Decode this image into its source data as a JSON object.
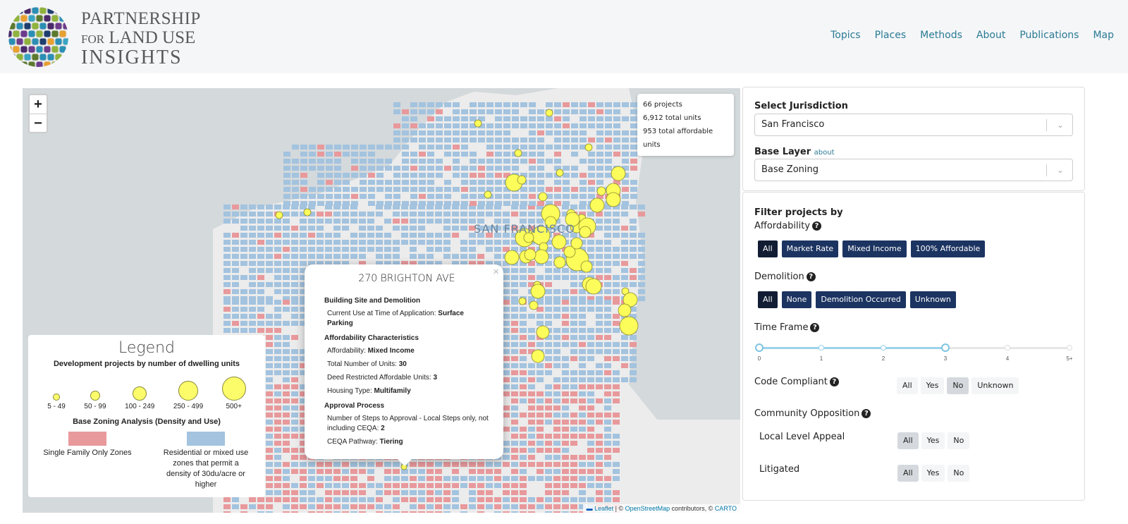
{
  "header": {
    "brand": {
      "line1": "PARTNERSHIP",
      "line2_small": "FOR",
      "line2": "LAND USE",
      "line3": "INSIGHTS"
    },
    "nav": [
      "Topics",
      "Places",
      "Methods",
      "About",
      "Publications",
      "Map"
    ]
  },
  "map": {
    "zoom_in": "+",
    "zoom_out": "−",
    "city_label": "SAN FRANCISCO",
    "stats": {
      "projects": "66 projects",
      "total_units": "6,912 total units",
      "affordable_units": "953 total affordable units"
    },
    "attribution": {
      "leaflet": "Leaflet",
      "sep": " | © ",
      "osm": "OpenStreetMap",
      "contrib": " contributors, © ",
      "carto": "CARTO"
    },
    "colors": {
      "water": "#d4d9dc",
      "land": "#ececec",
      "single_family": "#e8999c",
      "residential_mixed": "#a3c3df",
      "project": "#fcfc5a"
    },
    "legend": {
      "title": "Legend",
      "subtitle": "Development projects by number of dwelling units",
      "sizes": [
        "5 - 49",
        "50 - 99",
        "100 - 249",
        "250 - 499",
        "500+"
      ],
      "zoning_title": "Base Zoning Analysis (Density and Use)",
      "zones": [
        {
          "label": "Single Family Only Zones",
          "color": "#e8999c"
        },
        {
          "label": "Residential or mixed use zones that permit a density of 30du/acre or higher",
          "color": "#a3c3df"
        }
      ]
    },
    "popup": {
      "title": "270 BRIGHTON AVE",
      "close": "×",
      "sections": [
        {
          "heading": "Building Site and Demolition",
          "rows": [
            {
              "k": "Current Use at Time of Application: ",
              "v": "Surface Parking"
            }
          ]
        },
        {
          "heading": "Affordability Characteristics",
          "rows": [
            {
              "k": "Affordability: ",
              "v": "Mixed Income"
            },
            {
              "k": "Total Number of Units: ",
              "v": "30"
            },
            {
              "k": "Deed Restricted Affordable Units: ",
              "v": "3"
            },
            {
              "k": "Housing Type: ",
              "v": "Multifamily"
            }
          ]
        },
        {
          "heading": "Approval Process",
          "rows": [
            {
              "k": "Number of Steps to Approval - Local Steps only, not including CEQA: ",
              "v": "2"
            },
            {
              "k": "CEQA Pathway: ",
              "v": "Tiering"
            }
          ]
        }
      ]
    }
  },
  "sidebar": {
    "jurisdiction_label": "Select Jurisdiction",
    "jurisdiction_value": "San Francisco",
    "base_layer_label": "Base Layer",
    "base_layer_about": "about",
    "base_layer_value": "Base Zoning",
    "filter_title": "Filter projects by",
    "affordability": {
      "label": "Affordability",
      "options": [
        "All",
        "Market Rate",
        "Mixed Income",
        "100% Affordable"
      ],
      "selected": "All"
    },
    "demolition": {
      "label": "Demolition",
      "options": [
        "All",
        "None",
        "Demolition Occurred",
        "Unknown"
      ],
      "selected": "All"
    },
    "time_frame": {
      "label": "Time Frame",
      "ticks": [
        "0",
        "1",
        "2",
        "3",
        "4",
        "5+"
      ],
      "range": [
        0,
        3
      ]
    },
    "code_compliant": {
      "label": "Code Compliant",
      "options": [
        "All",
        "Yes",
        "No",
        "Unknown"
      ],
      "selected": "No"
    },
    "community_opposition": {
      "label": "Community Opposition"
    },
    "local_appeal": {
      "label": "Local Level Appeal",
      "options": [
        "All",
        "Yes",
        "No"
      ],
      "selected": "All"
    },
    "litigated": {
      "label": "Litigated",
      "options": [
        "All",
        "Yes",
        "No"
      ],
      "selected": "All"
    }
  }
}
